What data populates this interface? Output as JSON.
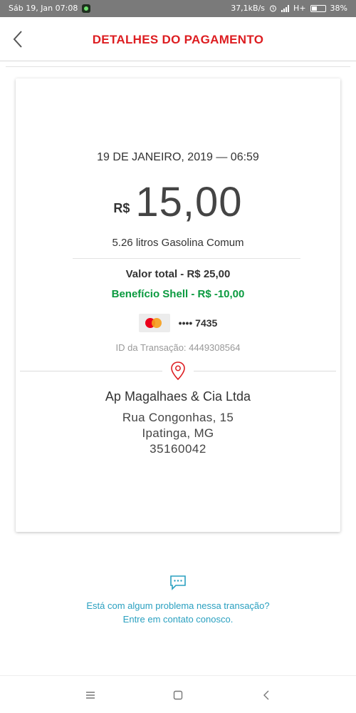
{
  "status_bar": {
    "time": "Sáb 19, Jan 07:08",
    "speed": "37,1kB/s",
    "network": "H+",
    "battery": "38%"
  },
  "header": {
    "title": "DETALHES DO PAGAMENTO",
    "back_icon": "chevron-left-icon"
  },
  "payment": {
    "date": "19 DE JANEIRO, 2019 — 06:59",
    "currency": "R$",
    "amount": "15,00",
    "liters": "5.26 litros Gasolina Comum",
    "total": "Valor total - R$ 25,00",
    "benefit": "Benefício Shell - R$ -10,00",
    "card_mask": "•••• 7435",
    "transaction_id": "ID da Transação: 4449308564"
  },
  "merchant": {
    "name": "Ap Magalhaes & Cia Ltda",
    "street": "Rua Congonhas, 15",
    "city": "Ipatinga, MG",
    "zip": "35160042"
  },
  "help": {
    "line1": "Está com algum problema nessa transação?",
    "line2": "Entre em contato conosco."
  },
  "colors": {
    "brand_red": "#dd1d21",
    "benefit_green": "#0a9a3f",
    "link_blue": "#2aa0c0"
  }
}
